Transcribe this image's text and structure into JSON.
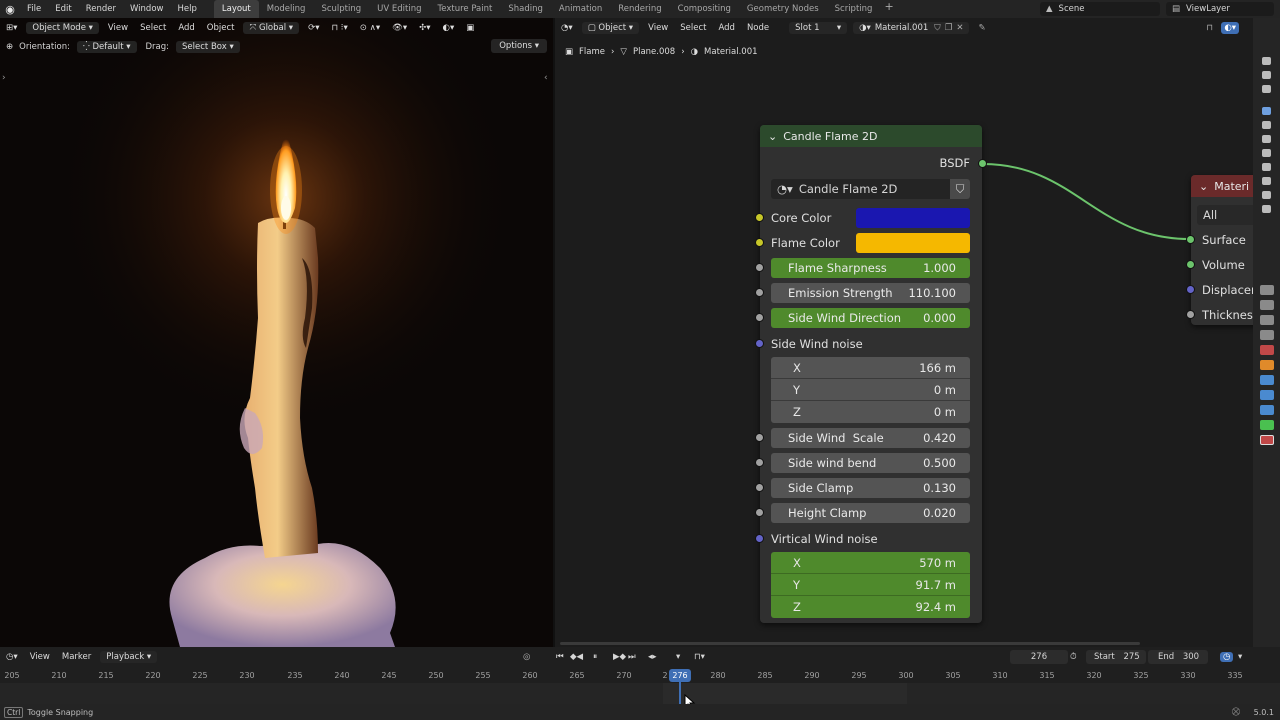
{
  "topbar": {
    "menus": [
      "File",
      "Edit",
      "Render",
      "Window",
      "Help"
    ],
    "workspaces": [
      "Layout",
      "Modeling",
      "Sculpting",
      "UV Editing",
      "Texture Paint",
      "Shading",
      "Animation",
      "Rendering",
      "Compositing",
      "Geometry Nodes",
      "Scripting"
    ],
    "active_workspace": "Layout",
    "scene": "Scene",
    "view_layer": "ViewLayer"
  },
  "viewport": {
    "mode": "Object Mode",
    "menus": [
      "View",
      "Select",
      "Add",
      "Object"
    ],
    "transform_space": "Global",
    "orientation_label": "Orientation:",
    "orientation_value": "Default",
    "drag_label": "Drag:",
    "drag_value": "Select Box",
    "options": "Options"
  },
  "node_editor": {
    "type_dropdown": "Object",
    "menus": [
      "View",
      "Select",
      "Add",
      "Node"
    ],
    "slot": "Slot 1",
    "material": "Material.001",
    "breadcrumb": [
      "Flame",
      "Plane.008",
      "Material.001"
    ]
  },
  "group_node": {
    "title": "Candle Flame 2D",
    "output_label": "BSDF",
    "datablock": "Candle Flame 2D",
    "color_inputs": [
      {
        "label": "Core Color",
        "color": "#1a17b0"
      },
      {
        "label": "Flame Color",
        "color": "#f5b800"
      }
    ],
    "fields_a": [
      {
        "label": "Flame Sharpness",
        "value": "1.000",
        "style": "green"
      },
      {
        "label": "Emission Strength",
        "value": "110.100",
        "style": "gray"
      },
      {
        "label": "Side Wind Direction",
        "value": "0.000",
        "style": "green"
      }
    ],
    "side_wind_noise": {
      "label": "Side Wind noise",
      "x": {
        "label": "X",
        "value": "166 m"
      },
      "y": {
        "label": "Y",
        "value": "0 m"
      },
      "z": {
        "label": "Z",
        "value": "0 m"
      }
    },
    "fields_b": [
      {
        "label": "Side Wind  Scale",
        "value": "0.420"
      },
      {
        "label": "Side wind bend",
        "value": "0.500"
      },
      {
        "label": "Side Clamp",
        "value": "0.130"
      },
      {
        "label": "Height Clamp",
        "value": "0.020"
      }
    ],
    "vertical_wind_noise": {
      "label": "Virtical Wind noise",
      "x": {
        "label": "X",
        "value": "570 m"
      },
      "y": {
        "label": "Y",
        "value": "91.7 m"
      },
      "z": {
        "label": "Z",
        "value": "92.4 m"
      }
    }
  },
  "output_node": {
    "title": "Materi",
    "target": "All",
    "inputs": [
      "Surface",
      "Volume",
      "Displacer",
      "Thickness"
    ]
  },
  "timeline": {
    "menus": [
      "View",
      "Marker",
      "Playback"
    ],
    "current_frame": "276",
    "start_label": "Start",
    "start": "275",
    "end_label": "End",
    "end": "300",
    "ticks": [
      "205",
      "210",
      "215",
      "220",
      "225",
      "230",
      "235",
      "240",
      "245",
      "250",
      "255",
      "260",
      "265",
      "270",
      "2",
      "280",
      "285",
      "290",
      "295",
      "300",
      "305",
      "310",
      "315",
      "320",
      "325",
      "330",
      "335"
    ]
  },
  "statusbar": {
    "key": "Ctrl",
    "hint": "Toggle Snapping",
    "version": "5.0.1"
  }
}
